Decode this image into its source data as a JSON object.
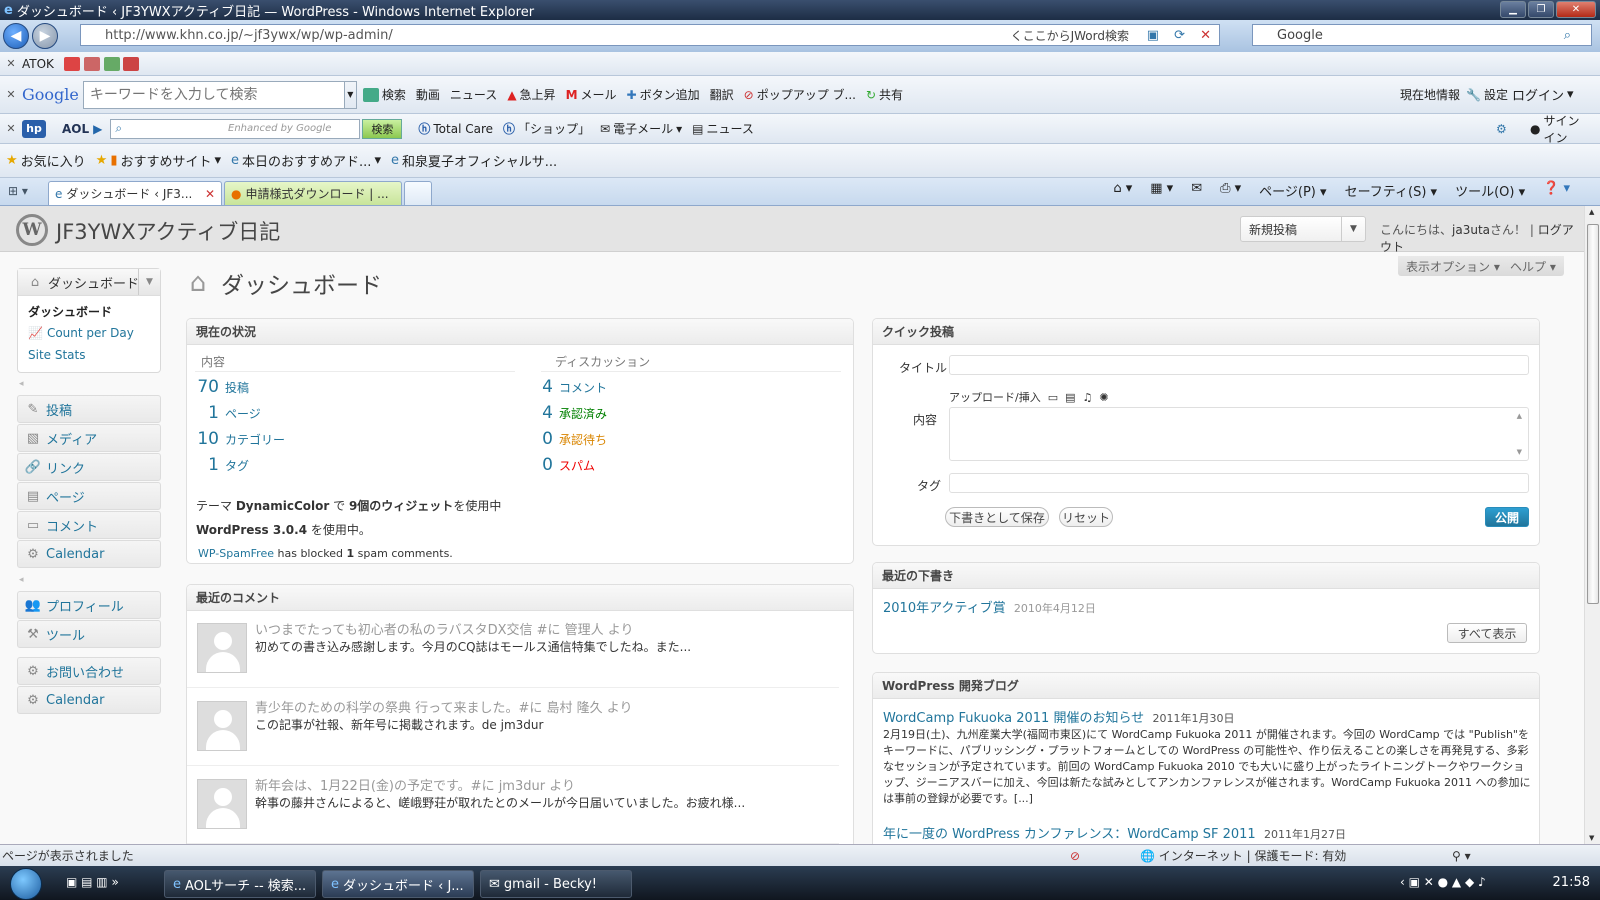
{
  "window": {
    "title": "ダッシュボード ‹ JF3YWXアクティブ日記 — WordPress - Windows Internet Explorer"
  },
  "address": {
    "url": "http://www.khn.co.jp/~jf3ywx/wp/wp-admin/",
    "jword": "くここからJWord検索",
    "search_value": "Google"
  },
  "toolbars": {
    "atok": "ATOK",
    "google": {
      "logo": "Google",
      "placeholder": "キーワードを入力して検索",
      "search": "検索",
      "items": [
        "動画",
        "ニュース",
        "急上昇",
        "メール",
        "ボタン追加",
        "翻訳",
        "ポップアップ ブ...",
        "共有"
      ],
      "right": [
        "現在地情報",
        "設定",
        "ログイン"
      ]
    },
    "aol": {
      "hp": "hp",
      "aol": "AOL",
      "enhanced": "Enhanced by Google",
      "search": "検索",
      "items": [
        "Total Care",
        "「ショップ」",
        "電子メール",
        "ニュース"
      ],
      "signin": "サインイン"
    },
    "fav": {
      "favorites": "お気に入り",
      "items": [
        "おすすめサイト",
        "本日のおすすめアド...",
        "和泉夏子オフィシャルサ..."
      ]
    }
  },
  "tabs": [
    {
      "label": "ダッシュボード ‹ JF3..."
    },
    {
      "label": "申請様式ダウンロード | ..."
    }
  ],
  "cmdbar": [
    "ページ(P)",
    "セーフティ(S)",
    "ツール(O)"
  ],
  "wp": {
    "logo": "W",
    "site_title": "JF3YWXアクティブ日記",
    "new_post": "新規投稿",
    "howdy": "こんにちは、",
    "user": "ja3uta",
    "howdy_suffix": "さん！",
    "logout": "ログアウト",
    "screen_options": "表示オプション ▾",
    "help": "ヘルプ ▾",
    "page_title": "ダッシュボード",
    "menu": {
      "dashboard": "ダッシュボード",
      "sub": [
        "ダッシュボード",
        "Count per Day",
        "Site Stats"
      ],
      "group1": [
        "投稿",
        "メディア",
        "リンク",
        "ページ",
        "コメント",
        "Calendar"
      ],
      "group2": [
        "プロフィール",
        "ツール"
      ],
      "group3": [
        "お問い合わせ",
        "Calendar"
      ]
    },
    "right_now": {
      "title": "現在の状況",
      "content_head": "内容",
      "discussion_head": "ディスカッション",
      "content": [
        {
          "n": "70",
          "l": "投稿"
        },
        {
          "n": "1",
          "l": "ページ"
        },
        {
          "n": "10",
          "l": "カテゴリー"
        },
        {
          "n": "1",
          "l": "タグ"
        }
      ],
      "discussion": [
        {
          "n": "4",
          "l": "コメント"
        },
        {
          "n": "4",
          "l": "承認済み"
        },
        {
          "n": "0",
          "l": "承認待ち"
        },
        {
          "n": "0",
          "l": "スパム"
        }
      ],
      "theme_pre": "テーマ ",
      "theme": "DynamicColor",
      "theme_mid": " で ",
      "widgets": "9個のウィジェット",
      "theme_post": "を使用中",
      "wp_version": "WordPress 3.0.4",
      "wp_version_post": " を使用中。",
      "spam_plugin": "WP-SpamFree",
      "spam_mid": " has blocked ",
      "spam_count": "1",
      "spam_post": " spam comments."
    },
    "recent_comments": {
      "title": "最近のコメント",
      "items": [
        {
          "post": "いつまでたっても初心者の私のラバスタDX交信 #",
          "by": "に 管理人 より",
          "excerpt": "初めての書き込み感謝します。今月のCQ誌はモールス通信特集でしたね。また..."
        },
        {
          "post": "青少年のための科学の祭典 行って来ました。#",
          "by": "に 島村 隆久 より",
          "excerpt": "この記事が社報、新年号に掲載されます。de jm3dur"
        },
        {
          "post": "新年会は、1月22日(金)の予定です。#",
          "by": "に jm3dur より",
          "excerpt": "幹事の藤井さんによると、嵯峨野荘が取れたとのメールが今日届いていました。お疲れ様..."
        }
      ]
    },
    "quick_press": {
      "title": "クイック投稿",
      "title_label": "タイトル",
      "upload_label": "アップロード/挿入",
      "content_label": "内容",
      "tags_label": "タグ",
      "save_draft": "下書きとして保存",
      "reset": "リセット",
      "publish": "公開"
    },
    "recent_drafts": {
      "title": "最近の下書き",
      "item": "2010年アクティブ賞",
      "date": "2010年4月12日",
      "view_all": "すべて表示"
    },
    "dev_blog": {
      "title": "WordPress 開発ブログ",
      "item1_title": "WordCamp Fukuoka 2011 開催のお知らせ",
      "item1_date": "2011年1月30日",
      "item1_body": "2月19日(土)、九州産業大学(福岡市東区)にて WordCamp Fukuoka 2011 が開催されます。今回の WordCamp では \"Publish\"をキーワードに、パブリッシング・プラットフォームとしての WordPress の可能性や、作り伝えることの楽しさを再発見する、多彩なセッションが予定されています。前回の WordCamp Fukuoka 2010 でも大いに盛り上がったライトニングトークやワークショップ、ジーニアスバーに加え、今回は新たな試みとしてアンカンファレンスが催されます。WordCamp Fukuoka 2011 への参加には事前の登録が必要です。[...]",
      "item2_title": "年に一度の WordPress カンファレンス：WordCamp SF 2011",
      "item2_date": "2011年1月27日"
    }
  },
  "status": {
    "text": "ページが表示されました",
    "zone": "インターネット | 保護モード: 有効"
  },
  "taskbar": {
    "items": [
      "AOLサーチ -- 検索...",
      "ダッシュボード ‹ J...",
      "gmail - Becky!"
    ],
    "clock": "21:58"
  }
}
